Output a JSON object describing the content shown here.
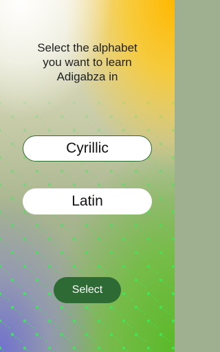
{
  "screen": {
    "title": "Select the alphabet you want to learn Adigabza in"
  },
  "options": [
    {
      "label": "Cyrillic",
      "selected": true
    },
    {
      "label": "Latin",
      "selected": false
    }
  ],
  "actions": {
    "select_label": "Select"
  },
  "colors": {
    "accent": "#2d6a34",
    "option_background": "#ffffff",
    "selected_border": "#2f6a2f",
    "dot_green": "#3ee85a"
  }
}
